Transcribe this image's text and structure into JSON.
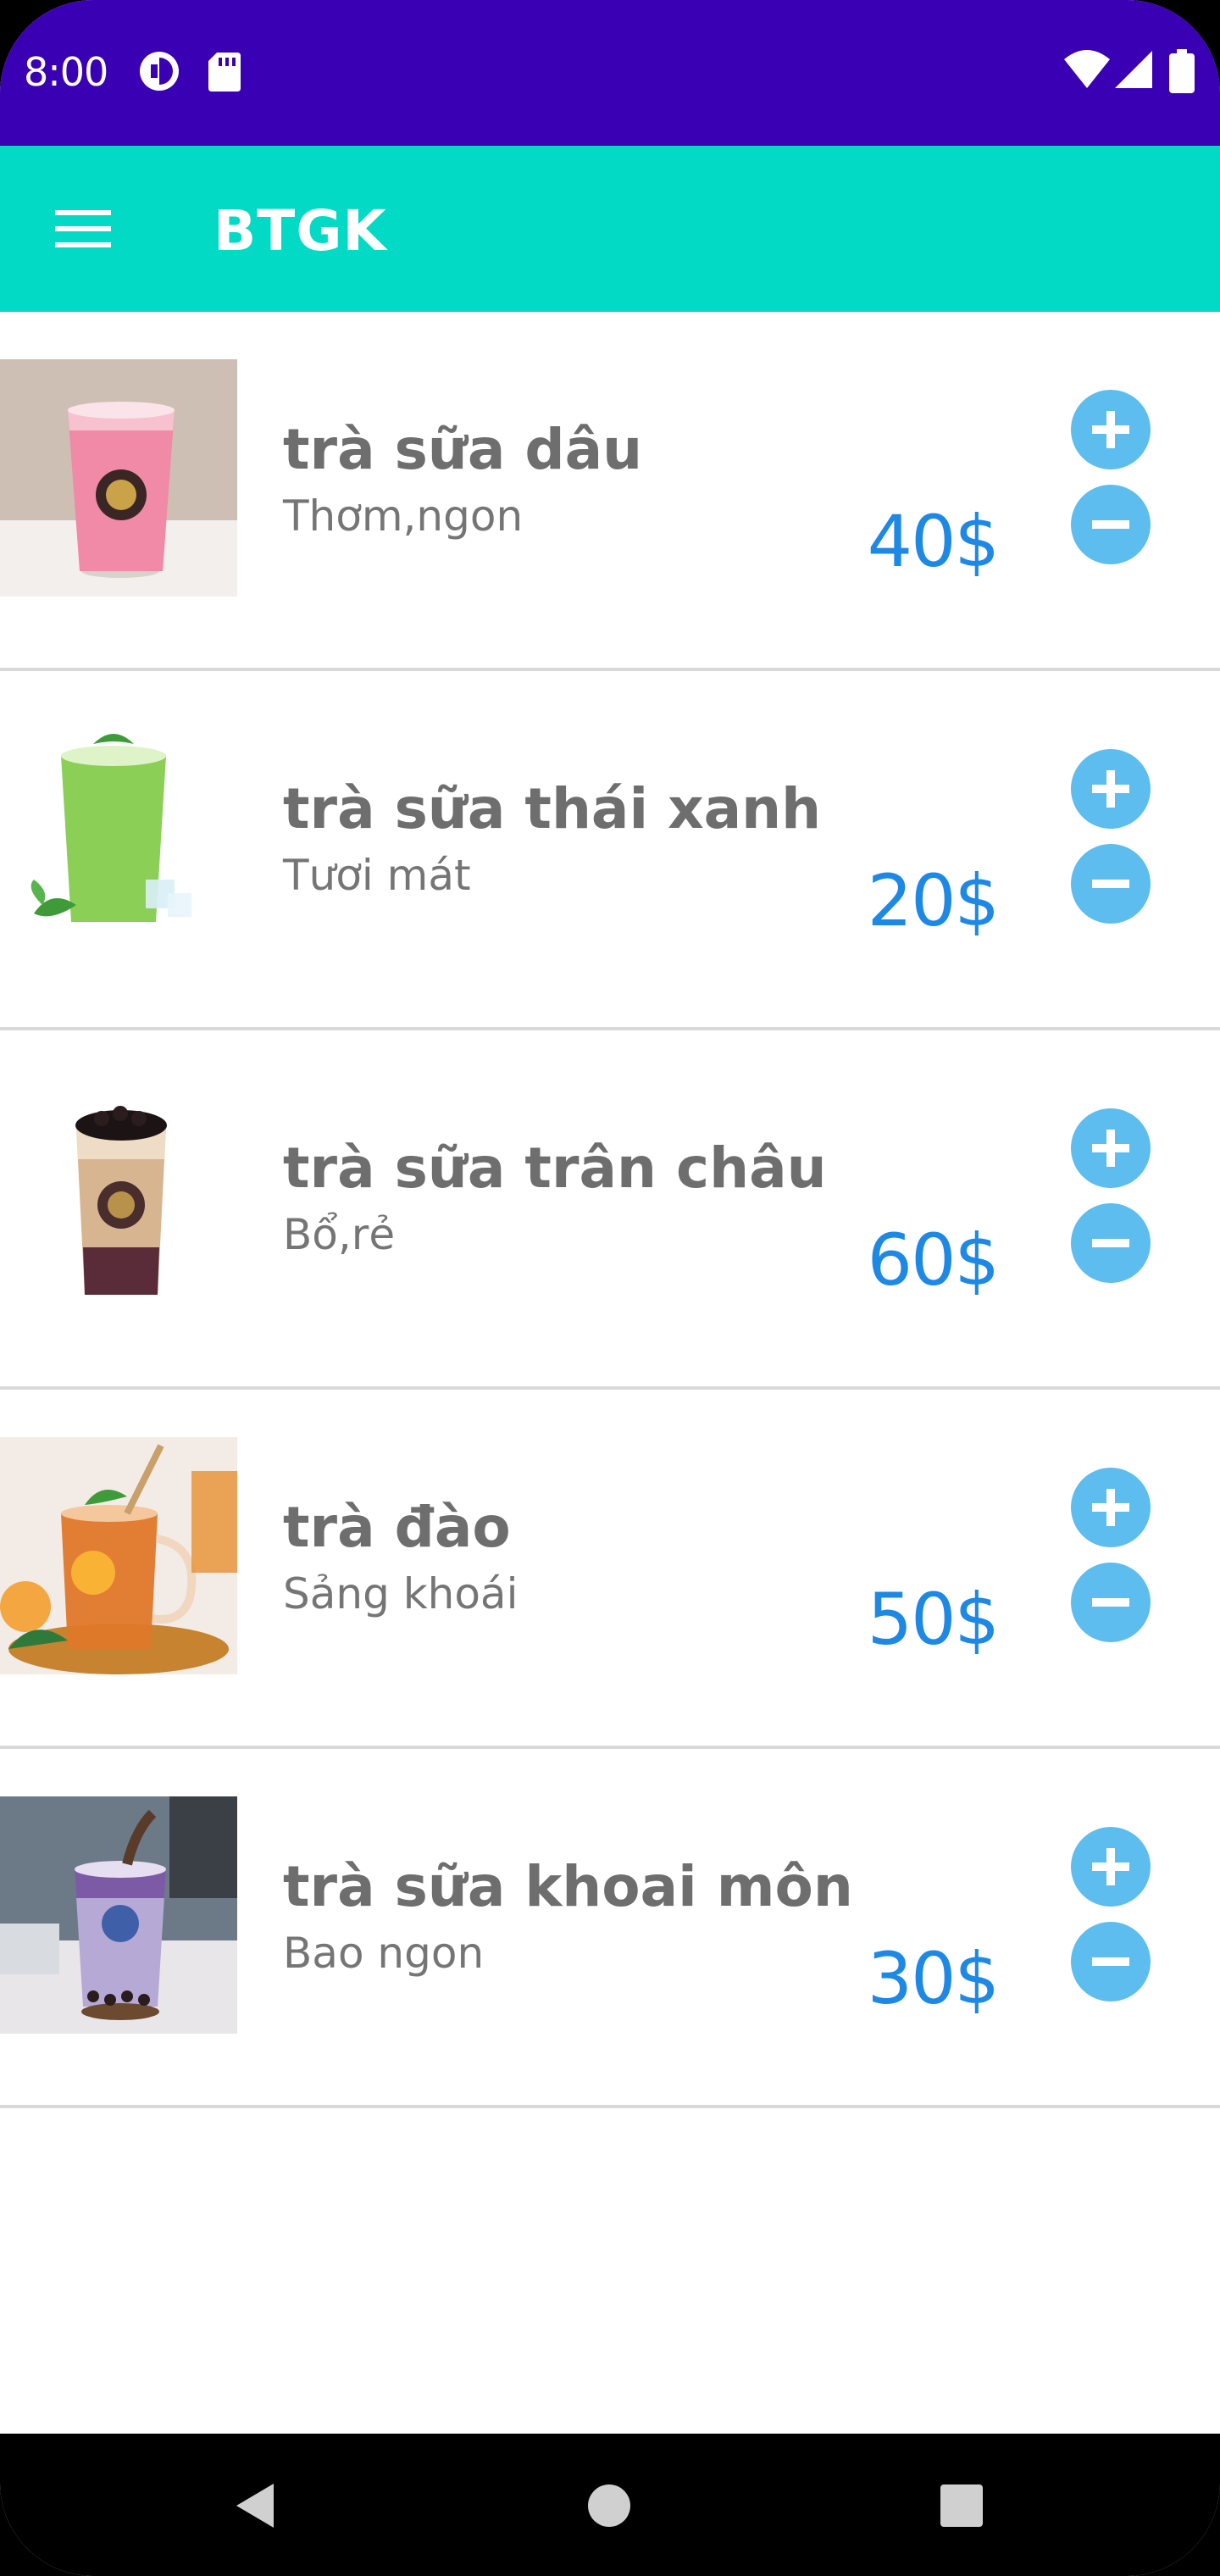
{
  "status_bar": {
    "time": "8:00",
    "icons": [
      "data-saver-icon",
      "sd-card-icon",
      "wifi-icon",
      "signal-icon",
      "battery-icon"
    ]
  },
  "app_bar": {
    "title": "BTGK",
    "menu_icon": "menu-icon"
  },
  "colors": {
    "status_bar": "#3a00b4",
    "app_bar": "#03dac5",
    "price": "#1e88e5",
    "action_button": "#5cbdee",
    "item_text": "#6e6e6e"
  },
  "products": [
    {
      "name": "trà sữa dâu",
      "description": "Thơm,ngon",
      "price": "40$",
      "image": "strawberry-milk-tea"
    },
    {
      "name": "trà sữa thái xanh",
      "description": "Tươi mát",
      "price": "20$",
      "image": "green-thai-milk-tea"
    },
    {
      "name": "trà sữa trân châu",
      "description": "Bổ,rẻ",
      "price": "60$",
      "image": "pearl-milk-tea"
    },
    {
      "name": "trà đào",
      "description": "Sảng khoái",
      "price": "50$",
      "image": "peach-tea"
    },
    {
      "name": "trà sữa khoai môn",
      "description": "Bao ngon",
      "price": "30$",
      "image": "taro-milk-tea"
    }
  ],
  "nav_bar": {
    "buttons": [
      "back-icon",
      "home-icon",
      "recents-icon"
    ]
  }
}
